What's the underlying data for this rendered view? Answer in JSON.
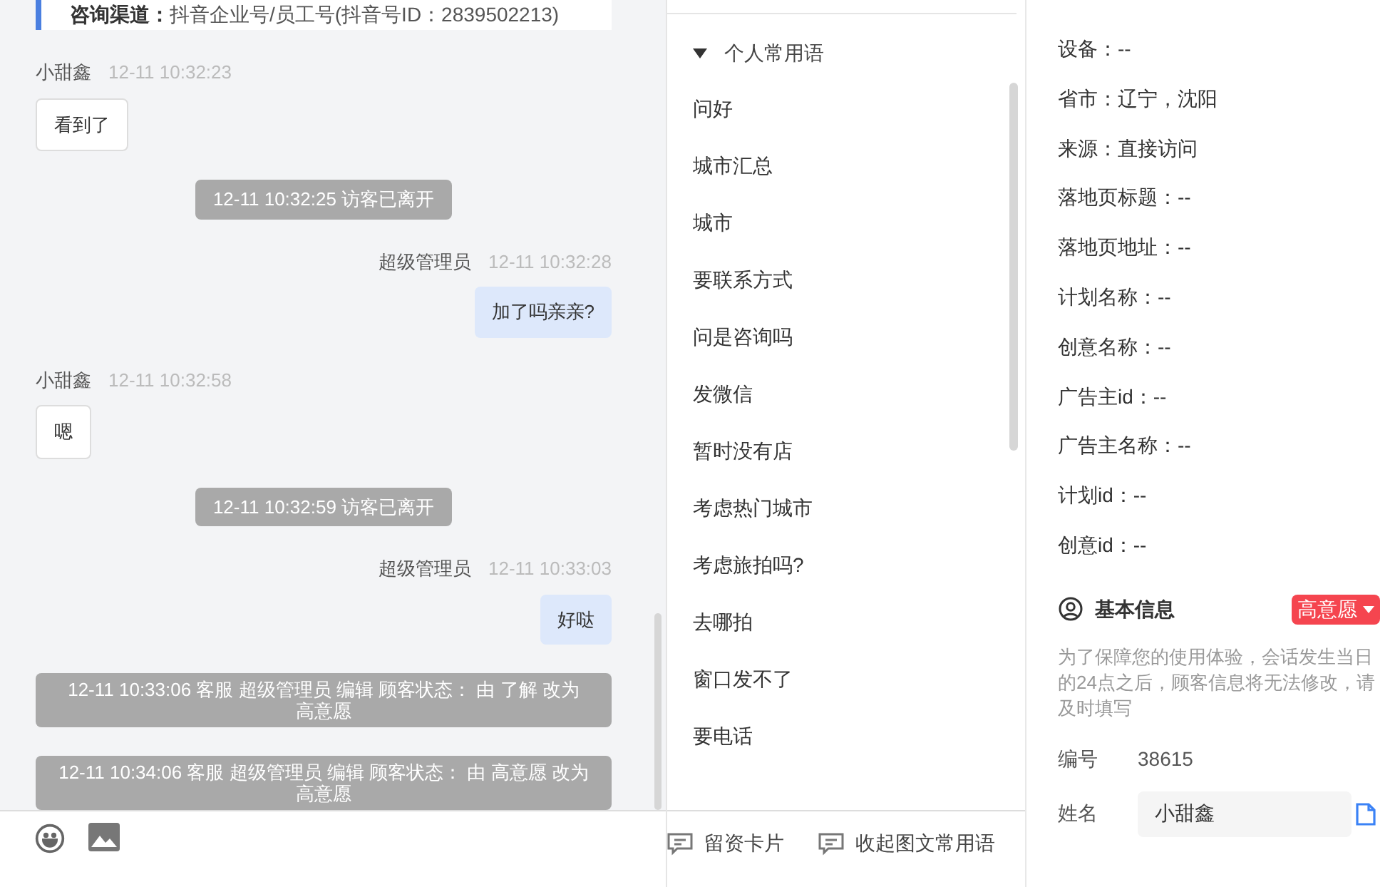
{
  "channel_card": {
    "label": "咨询渠道：",
    "value": "抖音企业号/员工号(抖音号ID：2839502213)"
  },
  "messages": [
    {
      "kind": "visitor",
      "sender": "小甜鑫",
      "time": "12-11 10:32:23",
      "text": "看到了"
    },
    {
      "kind": "notice",
      "text": "12-11 10:32:25 访客已离开"
    },
    {
      "kind": "agent",
      "sender": "超级管理员",
      "time": "12-11 10:32:28",
      "text": "加了吗亲亲?"
    },
    {
      "kind": "visitor",
      "sender": "小甜鑫",
      "time": "12-11 10:32:58",
      "text": "嗯"
    },
    {
      "kind": "notice",
      "text": "12-11 10:32:59 访客已离开"
    },
    {
      "kind": "agent",
      "sender": "超级管理员",
      "time": "12-11 10:33:03",
      "text": "好哒"
    },
    {
      "kind": "log",
      "lines": [
        "12-11 10:33:06 客服 超级管理员 编辑 顾客状态： 由 了解 改为",
        "高意愿"
      ]
    },
    {
      "kind": "log",
      "lines": [
        "12-11 10:34:06 客服 超级管理员 编辑 顾客状态： 由 高意愿 改为",
        "高意愿"
      ]
    }
  ],
  "phrases": {
    "group": {
      "title": "个人常用语",
      "expanded": true
    },
    "items": [
      "问好",
      "城市汇总",
      "城市",
      "要联系方式",
      "问是咨询吗",
      "发微信",
      "暂时没有店",
      "考虑热门城市",
      "考虑旅拍吗?",
      "去哪拍",
      "窗口发不了",
      "要电话"
    ],
    "actions": [
      "留资卡片",
      "收起图文常用语"
    ]
  },
  "source_info": [
    "设备：--",
    "省市：辽宁，沈阳",
    "来源：直接访问",
    "落地页标题：--",
    "落地页地址：--",
    "计划名称：--",
    "创意名称：--",
    "广告主id：--",
    "广告主名称：--",
    "计划id：--",
    "创意id：--"
  ],
  "basic_info": {
    "title": "基本信息",
    "status": "高意愿",
    "notice": "为了保障您的使用体验，会话发生当日的24点之后，顾客信息将无法修改，请及时填写",
    "fields": [
      {
        "kind": "text",
        "label": "编号",
        "value": "38615"
      },
      {
        "kind": "input",
        "label": "姓名",
        "value": "小甜鑫"
      }
    ]
  }
}
